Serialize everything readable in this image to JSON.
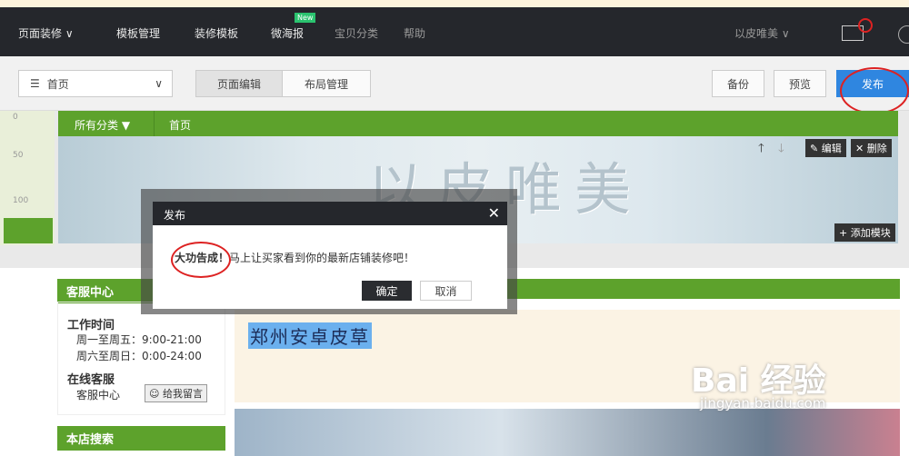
{
  "nav": {
    "items": [
      "页面装修 ∨",
      "模板管理",
      "装修模板",
      "微海报",
      "宝贝分类",
      "帮助"
    ],
    "new_badge": "New",
    "shop_name": "以皮唯美 ∨"
  },
  "toolbar": {
    "page_select": "首页",
    "tabs": [
      "页面编辑",
      "布局管理"
    ],
    "backup": "备份",
    "preview": "预览",
    "publish": "发布"
  },
  "ruler": {
    "ticks": [
      "0",
      "50",
      "100"
    ]
  },
  "shop_nav": {
    "items": [
      "所有分类 ▼",
      "首页"
    ]
  },
  "banner": {
    "title": "以皮唯美",
    "edit": "编辑",
    "delete": "删除",
    "add_module": "+ 添加模块"
  },
  "dialog": {
    "title": "发布",
    "message_bold": "大功告成！",
    "message": "马上让买家看到你的最新店铺装修吧！",
    "ok": "确定",
    "cancel": "取消"
  },
  "sidebar": {
    "service_title": "客服中心",
    "work_time_label": "工作时间",
    "weekday": "周一至周五：9:00-21:00",
    "weekend": "周六至周日：0:00-24:00",
    "online_label": "在线客服",
    "service_name": "客服中心",
    "message_btn": "给我留言",
    "search_title": "本店搜索"
  },
  "main": {
    "shop_title": "郑州安卓皮草"
  },
  "watermark": {
    "brand": "Bai 经验",
    "url": "jingyan.baidu.com"
  }
}
